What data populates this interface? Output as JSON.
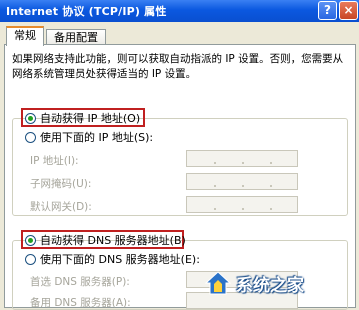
{
  "window": {
    "title": "Internet 协议 (TCP/IP) 属性",
    "help_label": "?",
    "close_label": "×"
  },
  "tabs": [
    {
      "label": "常规",
      "active": true
    },
    {
      "label": "备用配置",
      "active": false
    }
  ],
  "description": "如果网络支持此功能，则可以获取自动指派的 IP 设置。否则，您需要从网络系统管理员处获得适当的 IP 设置。",
  "ip_section": {
    "auto_label": "自动获得 IP 地址(O)",
    "auto_selected": true,
    "manual_label": "使用下面的 IP 地址(S):",
    "manual_selected": false,
    "fields": [
      {
        "label": "IP 地址(I):",
        "value": ""
      },
      {
        "label": "子网掩码(U):",
        "value": ""
      },
      {
        "label": "默认网关(D):",
        "value": ""
      }
    ]
  },
  "dns_section": {
    "auto_label": "自动获得 DNS 服务器地址(B)",
    "auto_selected": true,
    "manual_label": "使用下面的 DNS 服务器地址(E):",
    "manual_selected": false,
    "fields": [
      {
        "label": "首选 DNS 服务器(P):",
        "value": ""
      },
      {
        "label": "备用 DNS 服务器(A):",
        "value": ""
      }
    ]
  },
  "watermark": {
    "text": "系统之家"
  },
  "colors": {
    "titlebar": "#0b58e0",
    "highlight": "#c02020",
    "face": "#ece9d8"
  }
}
